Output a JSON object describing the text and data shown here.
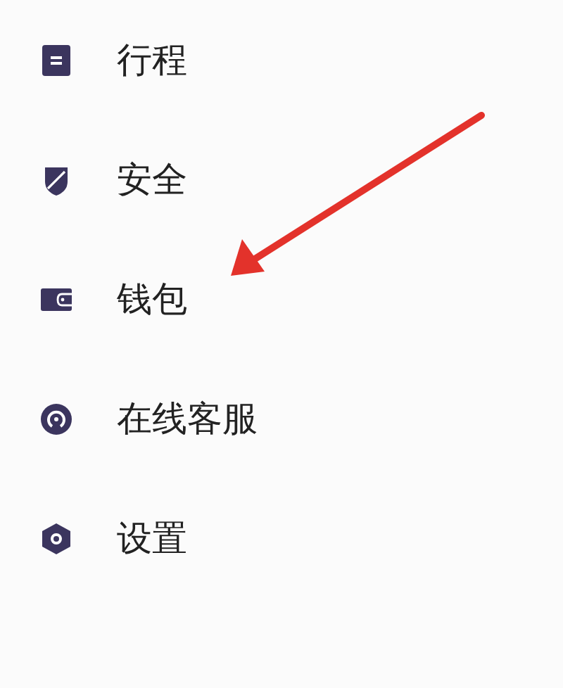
{
  "menu": {
    "items": [
      {
        "label": "行程"
      },
      {
        "label": "安全"
      },
      {
        "label": "钱包"
      },
      {
        "label": "在线客服"
      },
      {
        "label": "设置"
      }
    ]
  }
}
